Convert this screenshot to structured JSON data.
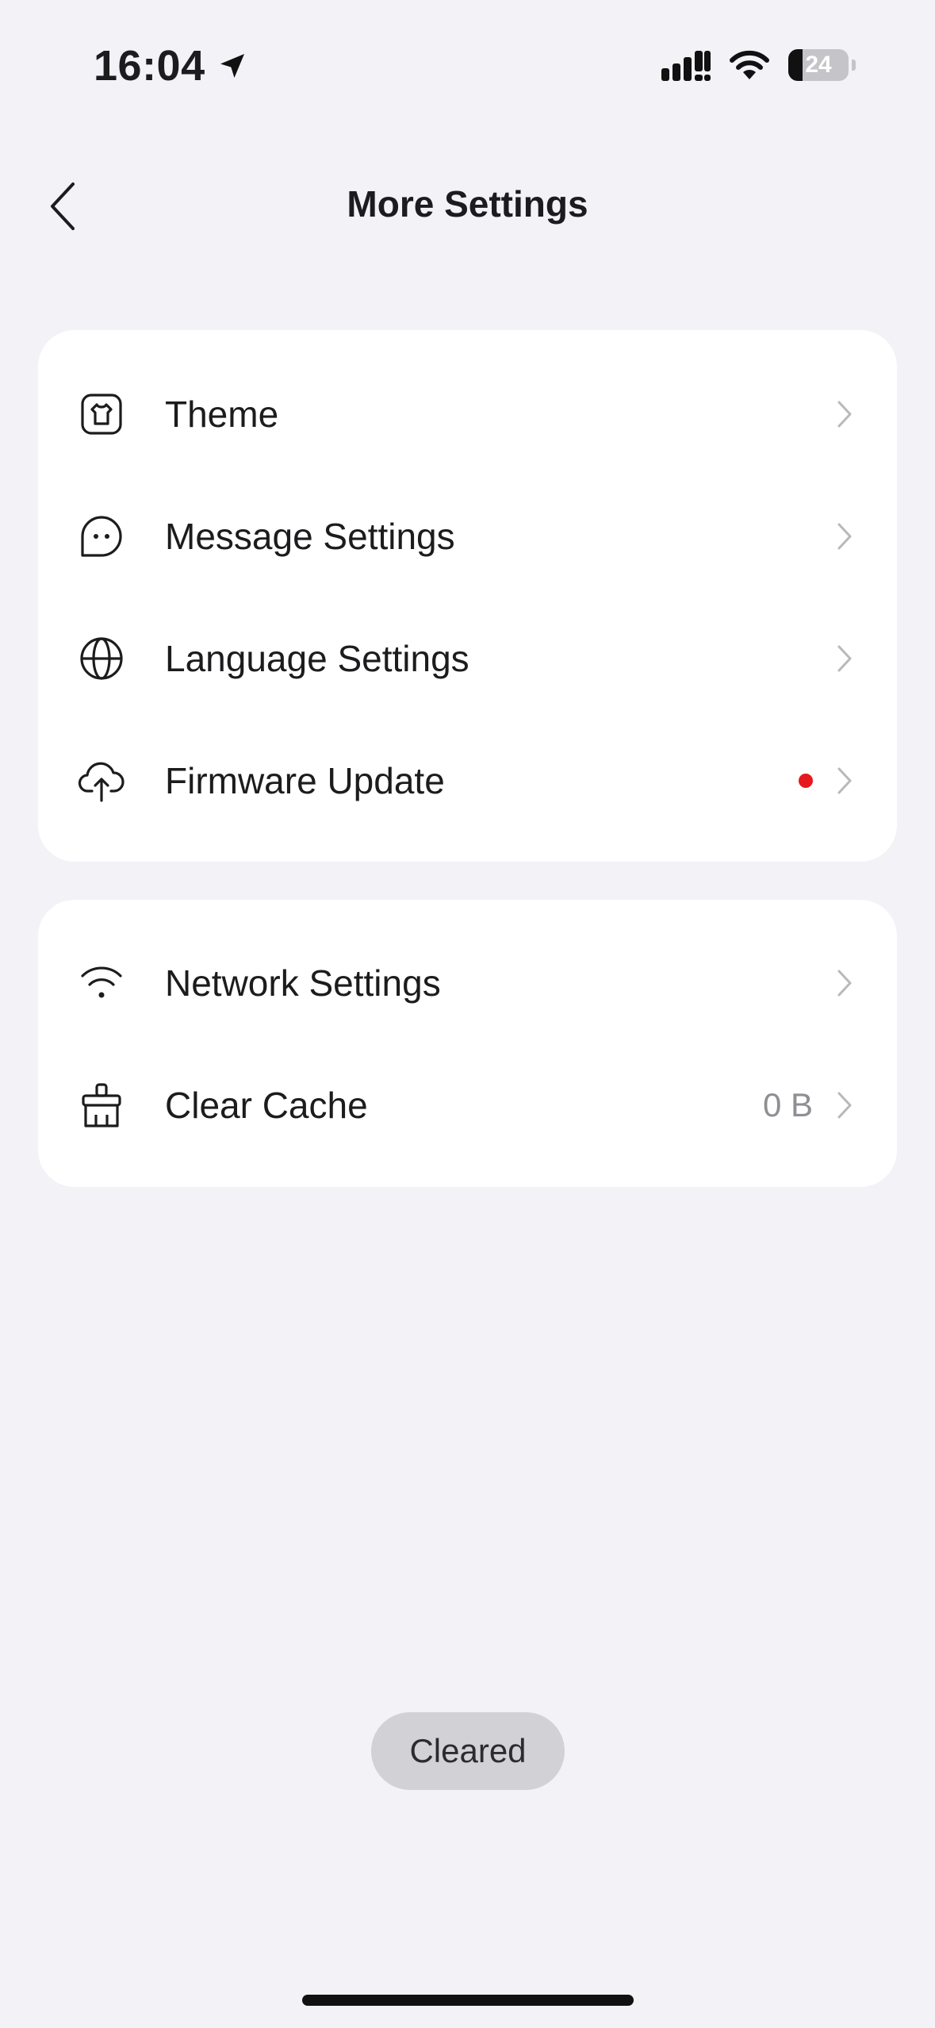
{
  "status_bar": {
    "time": "16:04",
    "battery_level": "24",
    "icons": [
      "location-arrow-icon",
      "cellular-signal-icon",
      "wifi-icon",
      "battery-icon"
    ]
  },
  "nav": {
    "title": "More Settings",
    "back_icon": "chevron-left-icon"
  },
  "group1": {
    "items": [
      {
        "label": "Theme",
        "icon": "tshirt-icon"
      },
      {
        "label": "Message Settings",
        "icon": "chat-bubble-icon"
      },
      {
        "label": "Language Settings",
        "icon": "globe-icon"
      },
      {
        "label": "Firmware Update",
        "icon": "cloud-upload-icon",
        "badge": "red-dot"
      }
    ]
  },
  "group2": {
    "items": [
      {
        "label": "Network Settings",
        "icon": "wifi-icon"
      },
      {
        "label": "Clear Cache",
        "icon": "broom-icon",
        "value": "0 B"
      }
    ]
  },
  "toast": {
    "text": "Cleared"
  },
  "colors": {
    "background": "#f2f2f7",
    "card": "#ffffff",
    "text": "#1c1c1e",
    "secondary_text": "#8e8e93",
    "chevron": "#b8b8bd",
    "badge": "#e5191e",
    "toast_bg": "#d1d1d6"
  }
}
